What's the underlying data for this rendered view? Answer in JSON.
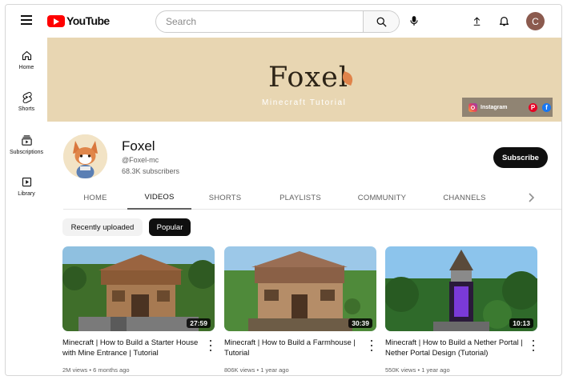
{
  "header": {
    "logo_text": "YouTube",
    "search_placeholder": "Search",
    "avatar_letter": "C"
  },
  "sidebar": {
    "items": [
      {
        "label": "Home",
        "icon": "home-icon"
      },
      {
        "label": "Shorts",
        "icon": "shorts-icon"
      },
      {
        "label": "Subscriptions",
        "icon": "subscriptions-icon"
      },
      {
        "label": "Library",
        "icon": "library-icon"
      }
    ]
  },
  "banner": {
    "title": "Foxel",
    "subtitle": "Minecraft Tutorial",
    "social_label": "Instagram",
    "pinterest_glyph": "P",
    "facebook_glyph": "f",
    "background_color": "#e8d6b2"
  },
  "channel": {
    "name": "Foxel",
    "handle": "@Foxel-mc",
    "subscribers": "68.3K subscribers",
    "subscribe_label": "Subscribe"
  },
  "tabs": [
    {
      "label": "HOME",
      "active": false
    },
    {
      "label": "VIDEOS",
      "active": true
    },
    {
      "label": "SHORTS",
      "active": false
    },
    {
      "label": "PLAYLISTS",
      "active": false
    },
    {
      "label": "COMMUNITY",
      "active": false
    },
    {
      "label": "CHANNELS",
      "active": false
    }
  ],
  "chips": [
    {
      "label": "Recently uploaded",
      "selected": false
    },
    {
      "label": "Popular",
      "selected": true
    }
  ],
  "videos": [
    {
      "duration": "27:59",
      "title": "Minecraft | How to Build a Starter House with Mine Entrance | Tutorial",
      "views": "2M views",
      "age": "6 months ago"
    },
    {
      "duration": "30:39",
      "title": "Minecraft | How to Build a Farmhouse | Tutorial",
      "views": "806K views",
      "age": "1 year ago"
    },
    {
      "duration": "10:13",
      "title": "Minecraft | How to Build a Nether Portal | Nether Portal Design (Tutorial)",
      "views": "550K views",
      "age": "1 year ago"
    }
  ],
  "meta_separator": "•"
}
